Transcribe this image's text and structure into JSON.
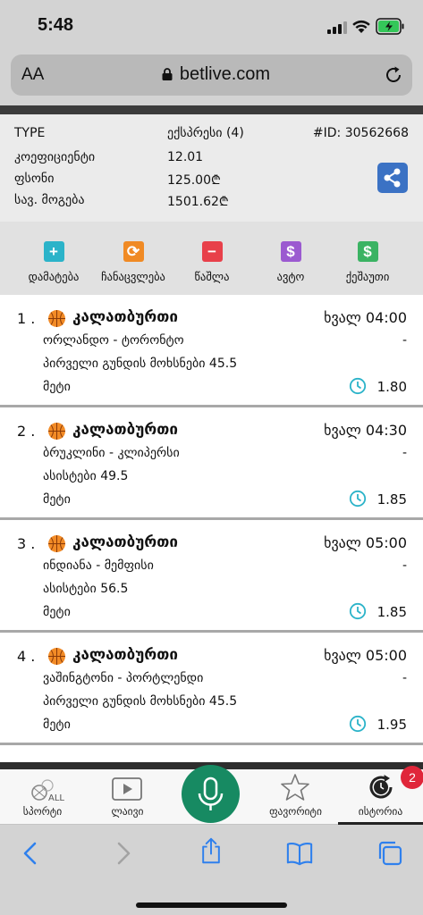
{
  "status_bar": {
    "time": "5:48"
  },
  "url_bar": {
    "aa": "AA",
    "url": "betlive.com"
  },
  "summary": {
    "type_label": "TYPE",
    "type_value": "ექსპრესი (4)",
    "id_text": "#ID: 30562668",
    "coef_label": "კოეფიციენტი",
    "coef_value": "12.01",
    "stake_label": "ფსონი",
    "stake_value": "125.00₾",
    "win_label": "სავ. მოგება",
    "win_value": "1501.62₾"
  },
  "actions": [
    {
      "label": "დამატება",
      "icon": "plus-icon",
      "color": "#2bb3c9",
      "glyph": "+"
    },
    {
      "label": "ჩანაცვლება",
      "icon": "replace-icon",
      "color": "#f08a24",
      "glyph": "⟳"
    },
    {
      "label": "წაშლა",
      "icon": "minus-icon",
      "color": "#e8404a",
      "glyph": "−"
    },
    {
      "label": "ავტო",
      "icon": "dollar-icon",
      "color": "#9b5ad0",
      "glyph": "$"
    },
    {
      "label": "ქეშაუთი",
      "icon": "dollar-icon",
      "color": "#3bb363",
      "glyph": "$"
    }
  ],
  "bets": [
    {
      "num": "1 .",
      "sport": "კალათბურთი",
      "time": "ხვალ 04:00",
      "teams": "ორლანდო - ტორონტო",
      "dash": "-",
      "market": "პირველი გუნდის მოხსნები 45.5",
      "outcome": "მეტი",
      "odds": "1.80"
    },
    {
      "num": "2 .",
      "sport": "კალათბურთი",
      "time": "ხვალ 04:30",
      "teams": "ბრუკლინი - კლიპერსი",
      "dash": "-",
      "market": "ასისტები 49.5",
      "outcome": "მეტი",
      "odds": "1.85"
    },
    {
      "num": "3 .",
      "sport": "კალათბურთი",
      "time": "ხვალ 05:00",
      "teams": "ინდიანა - მემფისი",
      "dash": "-",
      "market": "ასისტები 56.5",
      "outcome": "მეტი",
      "odds": "1.85"
    },
    {
      "num": "4 .",
      "sport": "კალათბურთი",
      "time": "ხვალ 05:00",
      "teams": "ვაშინგტონი - პორტლენდი",
      "dash": "-",
      "market": "პირველი გუნდის მოხსნები 45.5",
      "outcome": "მეტი",
      "odds": "1.95"
    }
  ],
  "bottom_nav": {
    "sports": "სპორტი",
    "sports_icon_text": "ALL",
    "live": "ლაივი",
    "favorites": "ფავორიტი",
    "history": "ისტორია",
    "badge": "2"
  },
  "colors": {
    "accent_green": "#178a62",
    "share_blue": "#3b72c4",
    "badge_red": "#e0263a",
    "clock_teal": "#2bb3c9"
  }
}
